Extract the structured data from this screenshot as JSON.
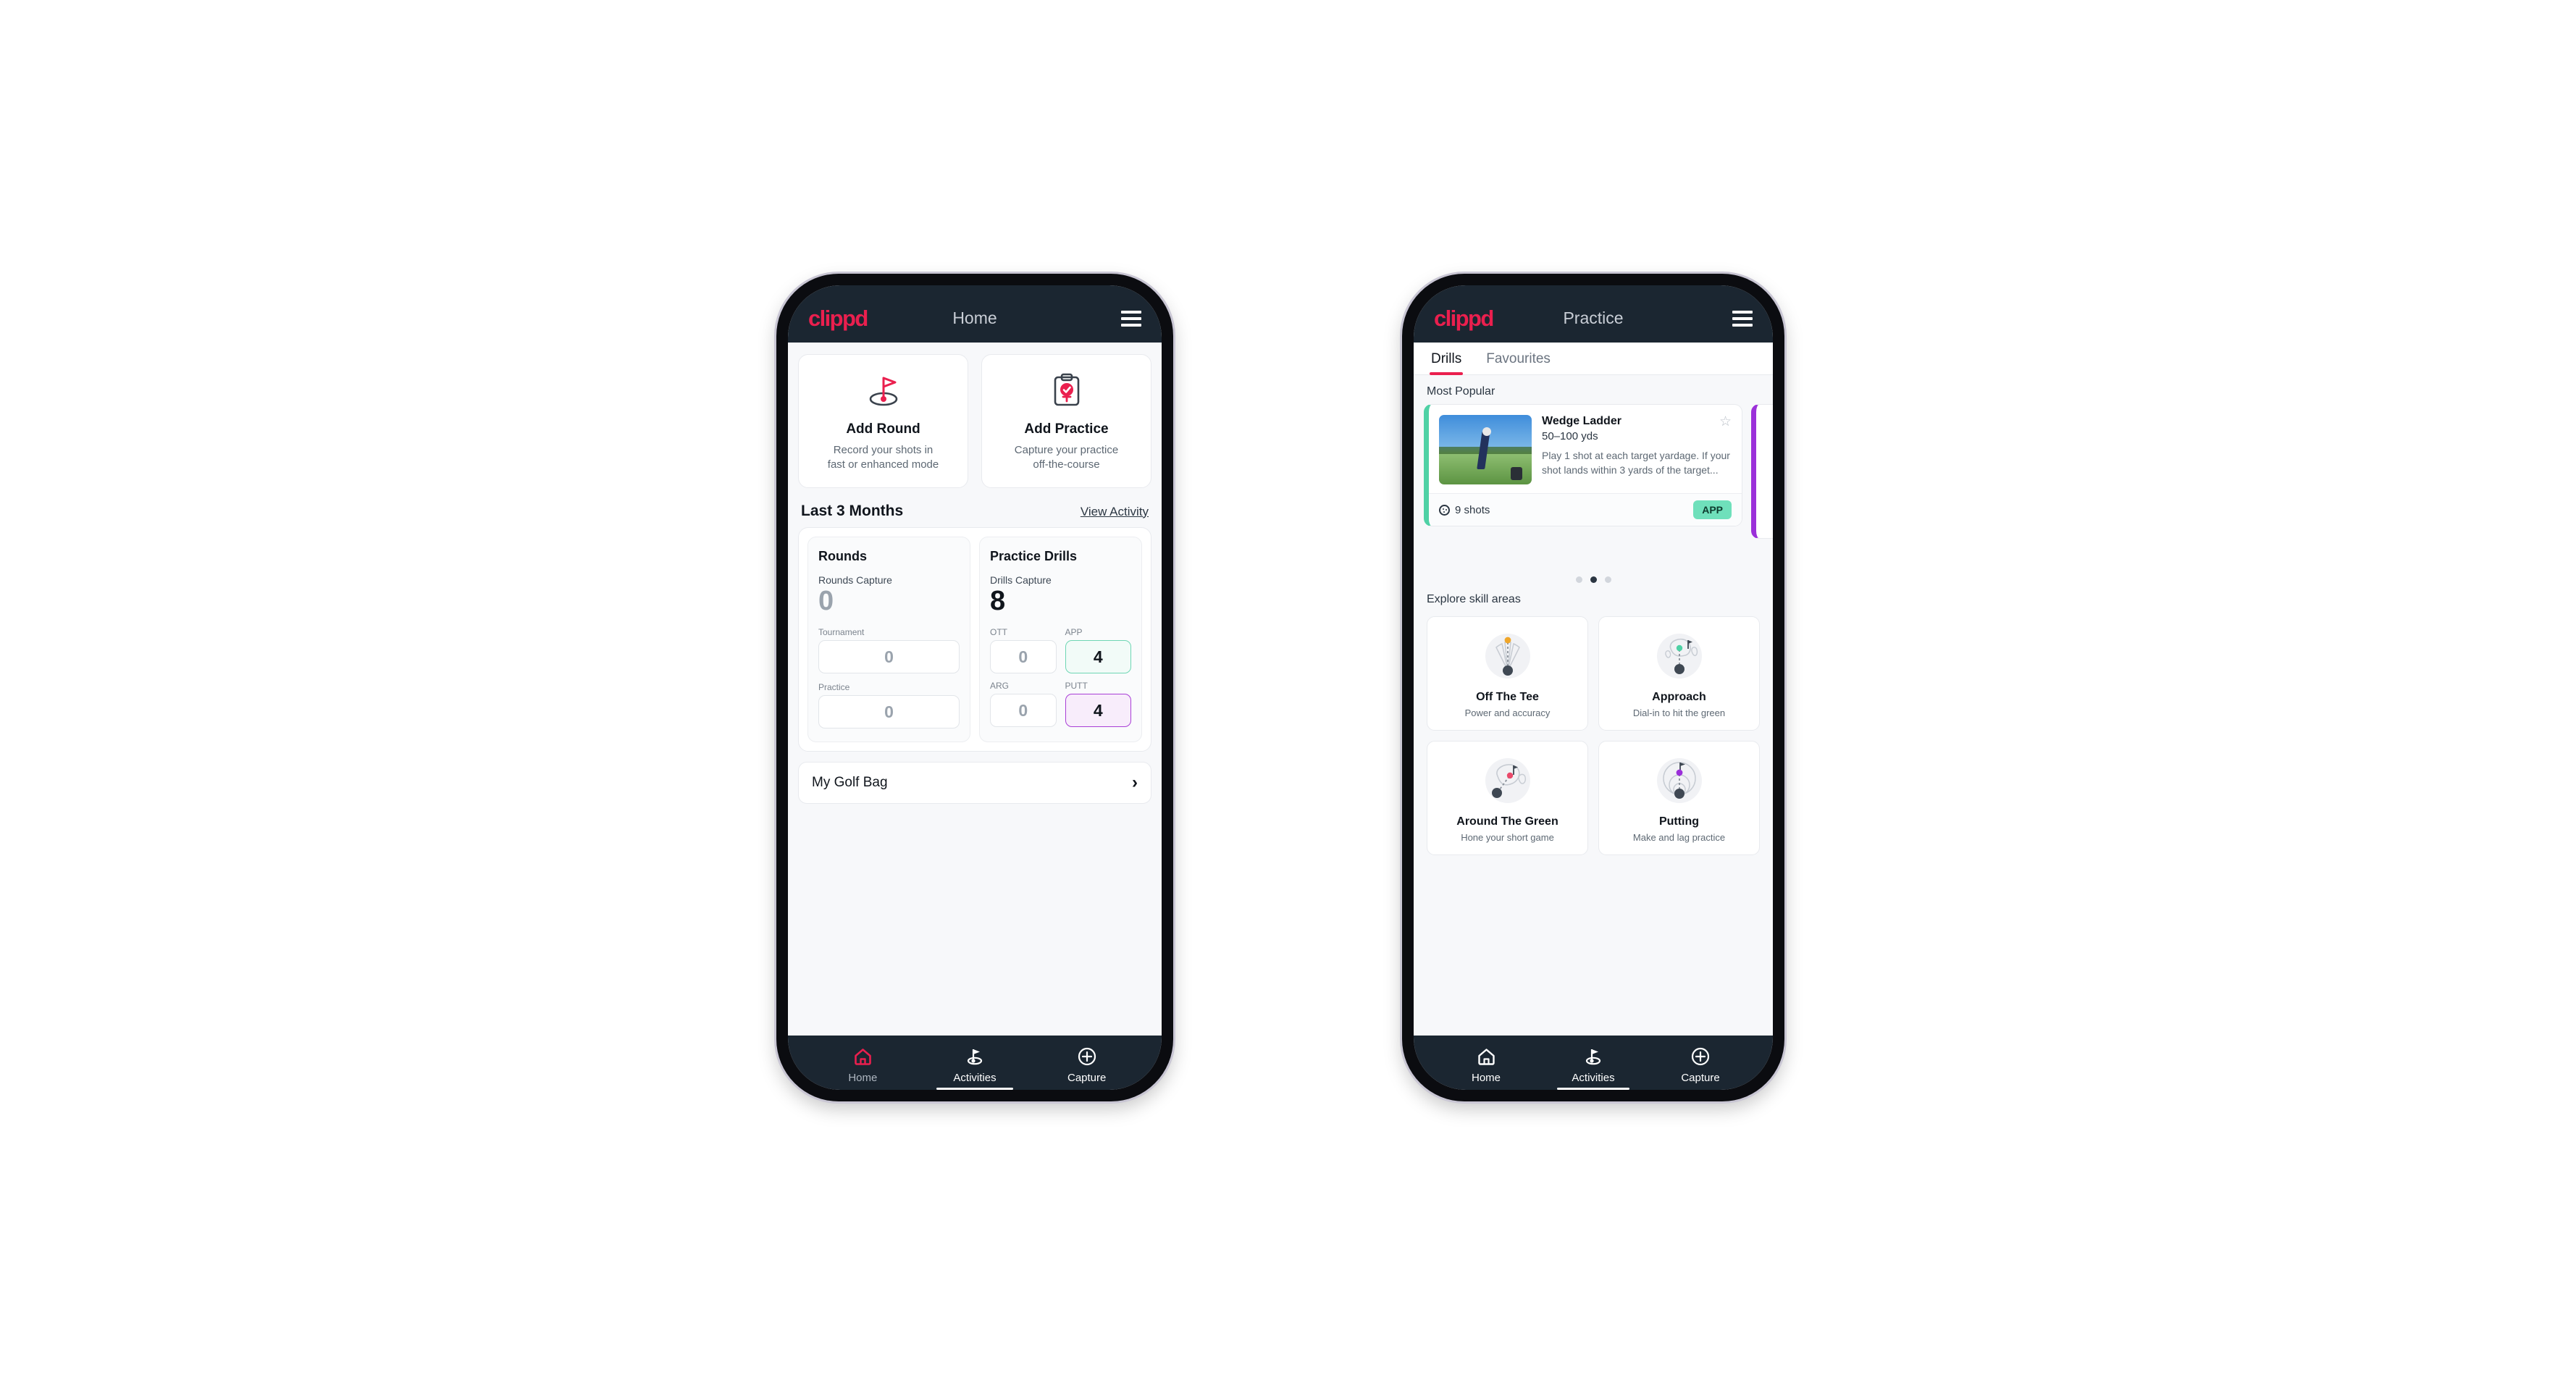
{
  "brand": {
    "logo_text": "clippd",
    "accent_pink": "#ea1f4e",
    "dark_navy": "#1b2631"
  },
  "phone_home": {
    "appbar": {
      "title": "Home",
      "menu_icon": "hamburger-menu-icon"
    },
    "quick_actions": [
      {
        "icon": "golf-flag-icon",
        "title": "Add Round",
        "subtitle_line1": "Record your shots in",
        "subtitle_line2": "fast or enhanced mode"
      },
      {
        "icon": "clipboard-check-icon",
        "title": "Add Practice",
        "subtitle_line1": "Capture your practice",
        "subtitle_line2": "off-the-course"
      }
    ],
    "section": {
      "title": "Last 3 Months",
      "link": "View Activity"
    },
    "rounds": {
      "heading": "Rounds",
      "capture_label": "Rounds Capture",
      "capture_value": "0",
      "tiles": [
        {
          "label": "Tournament",
          "value": "0",
          "style": "empty"
        },
        {
          "label": "Practice",
          "value": "0",
          "style": "empty"
        }
      ]
    },
    "drills": {
      "heading": "Practice Drills",
      "capture_label": "Drills Capture",
      "capture_value": "8",
      "tiles": [
        {
          "label": "OTT",
          "value": "0",
          "style": "empty"
        },
        {
          "label": "APP",
          "value": "4",
          "style": "mint"
        },
        {
          "label": "ARG",
          "value": "0",
          "style": "empty"
        },
        {
          "label": "PUTT",
          "value": "4",
          "style": "violet"
        }
      ]
    },
    "golf_bag": {
      "label": "My Golf Bag",
      "chevron": "›"
    },
    "bottom_nav": [
      {
        "label": "Home",
        "icon": "home-icon",
        "active": true
      },
      {
        "label": "Activities",
        "icon": "golf-flag-icon",
        "active": false
      },
      {
        "label": "Capture",
        "icon": "plus-circle-icon",
        "active": false
      }
    ]
  },
  "phone_practice": {
    "appbar": {
      "title": "Practice",
      "menu_icon": "hamburger-menu-icon"
    },
    "tabs": [
      {
        "label": "Drills",
        "active": true
      },
      {
        "label": "Favourites",
        "active": false
      }
    ],
    "most_popular_label": "Most Popular",
    "drill_card": {
      "title": "Wedge Ladder",
      "yardage": "50–100 yds",
      "description": "Play 1 shot at each target yardage. If your shot lands within 3 yards of the target...",
      "shots": "9 shots",
      "badge": "APP",
      "badge_color": "#6fe0bb",
      "accent_color": "#4fd1a5",
      "favourite_icon": "star-outline-icon",
      "shots_icon": "golf-ball-icon"
    },
    "next_card_accent": "#9b30d9",
    "carousel_dots": {
      "count": 3,
      "active_index": 1
    },
    "skill_label": "Explore skill areas",
    "skill_areas": [
      {
        "title": "Off The Tee",
        "subtitle": "Power and accuracy",
        "icon": "tee-fan-icon",
        "dot_color": "#f0a62a"
      },
      {
        "title": "Approach",
        "subtitle": "Dial-in to hit the green",
        "icon": "green-approach-icon",
        "dot_color": "#4fd1a5"
      },
      {
        "title": "Around The Green",
        "subtitle": "Hone your short game",
        "icon": "chip-green-icon",
        "dot_color": "#ea4a6b"
      },
      {
        "title": "Putting",
        "subtitle": "Make and lag practice",
        "icon": "putting-rings-icon",
        "dot_color": "#9b30d9"
      }
    ],
    "bottom_nav": [
      {
        "label": "Home",
        "icon": "home-icon",
        "active": false
      },
      {
        "label": "Activities",
        "icon": "golf-flag-icon",
        "active": true
      },
      {
        "label": "Capture",
        "icon": "plus-circle-icon",
        "active": false
      }
    ]
  }
}
